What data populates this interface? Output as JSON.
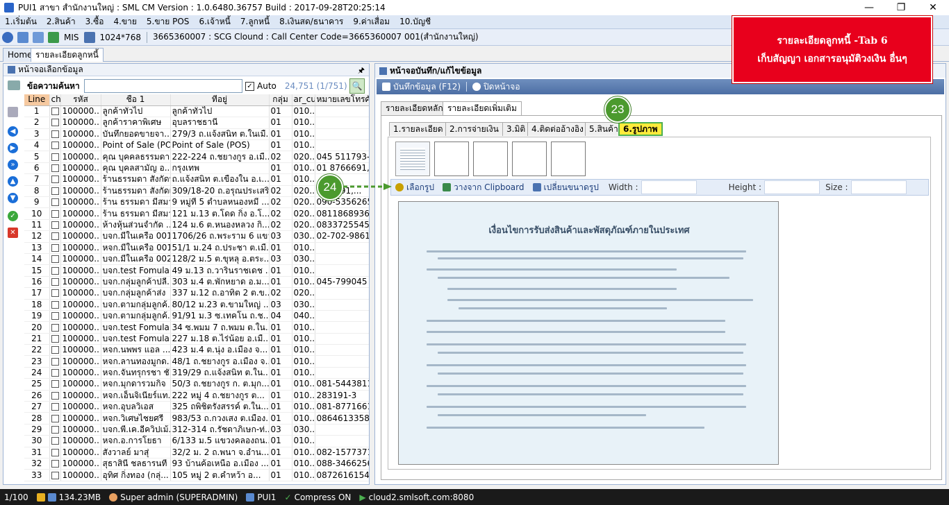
{
  "window": {
    "title": "PUI1 สาขา สำนักงานใหญ่ : SML CM Version : 1.0.6480.36757  Build : 2017-09-28T20:25:14"
  },
  "menu": [
    "1.เริ่มต้น",
    "2.สินค้า",
    "3.ซื้อ",
    "4.ขาย",
    "5.ขาย POS",
    "6.เจ้าหนี้",
    "7.ลูกหนี้",
    "8.เงินสด/ธนาคาร",
    "9.ค่าเสื่อม",
    "10.บัญชี"
  ],
  "toolbar": {
    "mis": "MIS",
    "resolution": "1024*768",
    "info": "3665360007 : SCG Clound : Call Center Code=3665360007 001(สำนักงานใหญ่)"
  },
  "tabs": [
    "Home",
    "รายละเอียดลูกหนี้"
  ],
  "left": {
    "title": "หน้าจอเลือกข้อมูล",
    "search_label": "ข้อความค้นหา",
    "search_value": "",
    "auto": "Auto",
    "count": "24,751 (1/751)",
    "columns": [
      "Line",
      "ch",
      "รหัส",
      "ชื่อ 1",
      "ที่อยู่",
      "กลุ่ม",
      "ar_cu",
      "หมายเลขโทรศัพ"
    ],
    "rows": [
      [
        "1",
        "100000..",
        "ลูกค้าทั่วไป",
        "ลูกค้าทั่วไป",
        "01",
        "010..",
        ""
      ],
      [
        "2",
        "100000..",
        "ลูกค้าราคาพิเศษ",
        "อุบลราชธานี",
        "01",
        "010..",
        ""
      ],
      [
        "3",
        "100000..",
        "บันทึกยอดขายจา...",
        "279/3 ถ.แจ้งสนิท ต.ในเมื...",
        "01",
        "010..",
        ""
      ],
      [
        "4",
        "100000..",
        "Point of Sale (PO...",
        "Point of Sale (POS)",
        "01",
        "010..",
        ""
      ],
      [
        "5",
        "100000..",
        "คุณ บุคคลธรรมดา ...",
        "222-224 ถ.ชยางกูร อ.เมื...",
        "02",
        "020..",
        "045 511793-4"
      ],
      [
        "6",
        "100000..",
        "คุณ บุคลสามัญ อ...",
        "กรุงเทพ",
        "01",
        "010..",
        "01 8766691,..."
      ],
      [
        "7",
        "100000..",
        "ร้านธรรมดา สังกัดบ้...",
        "ถ.แจ้งสนิท ต.เขื่องใน อ.เ...",
        "01",
        "010..",
        ""
      ],
      [
        "8",
        "100000..",
        "ร้านธรรมดา สังกัดเ...",
        "309/18-20 ถ.อรุณประเสริ...",
        "02",
        "020..",
        "...52491,..."
      ],
      [
        "9",
        "100000..",
        "ร้าน ธรรมดา มีสมา...",
        "9 หมู่ที่ 5 ตำบลหนองหมี ...",
        "02",
        "020..",
        "090-5356265"
      ],
      [
        "10",
        "100000..",
        "ร้าน ธรรมดา มีสมา...",
        "121 ม.13 ต.โดด กิ่ง อ.โ...",
        "02",
        "020..",
        "0811868936/..."
      ],
      [
        "11",
        "100000..",
        "ห้างหุ้นส่วนจำกัด ...",
        "124 ม.6 ต.หนองหลวง กิ่...",
        "02",
        "020..",
        "0833725545/..."
      ],
      [
        "12",
        "100000..",
        "บจก.มีในเครือ 001",
        "1706/26 ถ.พระราม 6 แขว...",
        "03",
        "030..",
        "02-702-9861-..."
      ],
      [
        "13",
        "100000..",
        "หจก.มีในเครือ 001",
        "51/1 ม.24 ถ.ประชา ต.เมื...",
        "01",
        "010..",
        ""
      ],
      [
        "14",
        "100000..",
        "บจก.มีในเครือ 002",
        "128/2 ม.5 ต.ขุหลุ อ.ตระ...",
        "03",
        "030..",
        ""
      ],
      [
        "15",
        "100000..",
        "บจก.test Fomula ...",
        "49 ม.13 ถ.วารินราชเดช ...",
        "01",
        "010..",
        ""
      ],
      [
        "16",
        "100000..",
        "บจก.กลุ่มลูกค้าปลี...",
        "303  ม.4  ต.พักหยาด อ.ม...",
        "01",
        "010..",
        "045-799045"
      ],
      [
        "17",
        "100000..",
        "บจก.กลุ่มลูกค้าส่ง",
        "337 ม.12 ถ.อาทิต 2 ต.ข...",
        "02",
        "020..",
        ""
      ],
      [
        "18",
        "100000..",
        "บจก.ตามกลุ่มลูกค้...",
        "80/12 ม.23 ต.ขามใหญ่ ...",
        "03",
        "030..",
        ""
      ],
      [
        "19",
        "100000..",
        "บจก.ตามกลุ่มลูกค้...",
        "91/91 ม.3 ซ.เทคโน ถ.ช...",
        "04",
        "040..",
        ""
      ],
      [
        "20",
        "100000..",
        "บจก.test Fomula ...",
        "34 ซ.พมม 7 ถ.พมม ต.ใน...",
        "01",
        "010..",
        ""
      ],
      [
        "21",
        "100000..",
        "บจก.test Fomula ...",
        "227 ม.18 ต.ไร่น้อย อ.เมื...",
        "01",
        "010..",
        ""
      ],
      [
        "22",
        "100000..",
        "หจก.นพพร แอล ...",
        "423 ม.4 ต.นุ่ง อ.เมือง จ...",
        "01",
        "010..",
        ""
      ],
      [
        "23",
        "100000..",
        "หจก.ลานทองมูกด...",
        "48/1 ถ.ชยางกูร อ.เมือง จ...",
        "01",
        "010..",
        ""
      ],
      [
        "24",
        "100000..",
        "หจก.จันทรุกรชา ชั...",
        "319/29 ถ.แจ้งสนิท ต.ใน...",
        "01",
        "010..",
        ""
      ],
      [
        "25",
        "100000..",
        "หจก.มุกดารวมกิจ",
        "50/3 ถ.ชยางกูร ก. ต.มุก...",
        "01",
        "010..",
        "081-5443811 ..."
      ],
      [
        "26",
        "100000..",
        "หจก.เอ็นจิเนียร์แท...",
        "222  หมู่ 4  ถ.ชยางกูร ต...",
        "01",
        "010..",
        "283191-3"
      ],
      [
        "27",
        "100000..",
        "หจก.อุบลวิเอส",
        "325 ถพิชิตรังสรรค์ ต.ใน...",
        "01",
        "010..",
        "081-8771661 ..."
      ],
      [
        "28",
        "100000..",
        "หจก.วิเศษไชยศรี",
        "983/53 ถ.กวงเสง ต.เมือง...",
        "01",
        "010..",
        "0864613358,..."
      ],
      [
        "29",
        "100000..",
        "บจก.พี.เค.อีควิปเม้...",
        "312-314 ถ.รัชดาภิเษก-ท่...",
        "03",
        "030..",
        ""
      ],
      [
        "30",
        "100000..",
        "หจก.อ.การโยธา",
        "6/133 ม.5 แขวงคลองถน...",
        "01",
        "010..",
        ""
      ],
      [
        "31",
        "100000..",
        "สังวาลย์ มาสุ่",
        "32/2  ม. 2 ถ.พนา จ.อำน...",
        "01",
        "010..",
        "082-1577371"
      ],
      [
        "32",
        "100000..",
        "สุธาสินี ชลธารนที",
        "93 บ้านค้อเหนือ อ.เมือง ...",
        "01",
        "010..",
        "088-3466256"
      ],
      [
        "33",
        "100000..",
        "อุทิศ กิ่งทอง (กลุ่...",
        "105  หมู่ 2  ต.คำหว้า  อ...",
        "01",
        "010..",
        "0872616154/..."
      ]
    ]
  },
  "right": {
    "title": "หน้าจอบันทึก/แก้ไขข้อมูล",
    "save": "บันทึกข้อมูล (F12)",
    "close": "ปิดหน้าจอ",
    "tabs_main": [
      "รายละเอียดหลัก",
      "รายละเอียดเพิ่มเติม"
    ],
    "tabs_sub": [
      "1.รายละเอียด",
      "2.การจ่ายเงิน",
      "3.มิติ",
      "4.ติดต่ออ้างอิง",
      "5.สินค้า",
      "6.รูปภาพ"
    ],
    "img_tools": {
      "select": "เลือกรูป",
      "paste": "วางจาก Clipboard",
      "resize": "เปลี่ยนขนาดรูป",
      "width": "Width :",
      "height": "Height :",
      "size": "Size :"
    },
    "doc_title": "เงื่อนไขการรับส่งสินค้าและพัสดุภัณฑ์ภายในประเทศ"
  },
  "callout": {
    "line1": "รายละเอียดลูกหนี้ -Tab 6",
    "line2": "เก็บสัญญา เอกสารอนุมัติวงเงิน อื่นๆ"
  },
  "markers": {
    "m23": "23",
    "m24": "24"
  },
  "status": {
    "page": "1/100",
    "memory": "134.23MB",
    "user": "Super admin (SUPERADMIN)",
    "branch": "PUI1",
    "compress": "Compress ON",
    "server": "cloud2.smlsoft.com:8080"
  }
}
